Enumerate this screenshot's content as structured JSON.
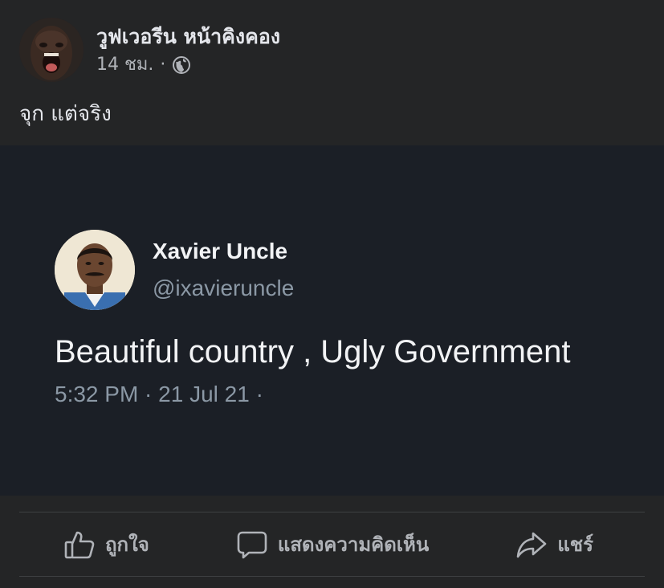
{
  "post": {
    "author_name": "วูฟเวอรีน หน้าคิงคอง",
    "time": "14 ชม.",
    "separator": "·",
    "privacy_icon": "globe-icon",
    "caption": "จุก แต่จริง"
  },
  "tweet": {
    "name": "Xavier Uncle",
    "handle": "@ixavieruncle",
    "text": "Beautiful country , Ugly Government",
    "timestamp": "5:32 PM · 21 Jul 21 ·"
  },
  "actions": {
    "like_label": "ถูกใจ",
    "like_icon": "thumbs-up-icon",
    "comment_label": "แสดงความคิดเห็น",
    "comment_icon": "comment-bubble-icon",
    "share_label": "แชร์",
    "share_icon": "share-arrow-icon"
  },
  "colors": {
    "background": "#242526",
    "tweet_background": "#1b1f26",
    "primary_text": "#e4e6eb",
    "secondary_text": "#b0b3b8",
    "tweet_secondary_text": "#8b98a5"
  }
}
